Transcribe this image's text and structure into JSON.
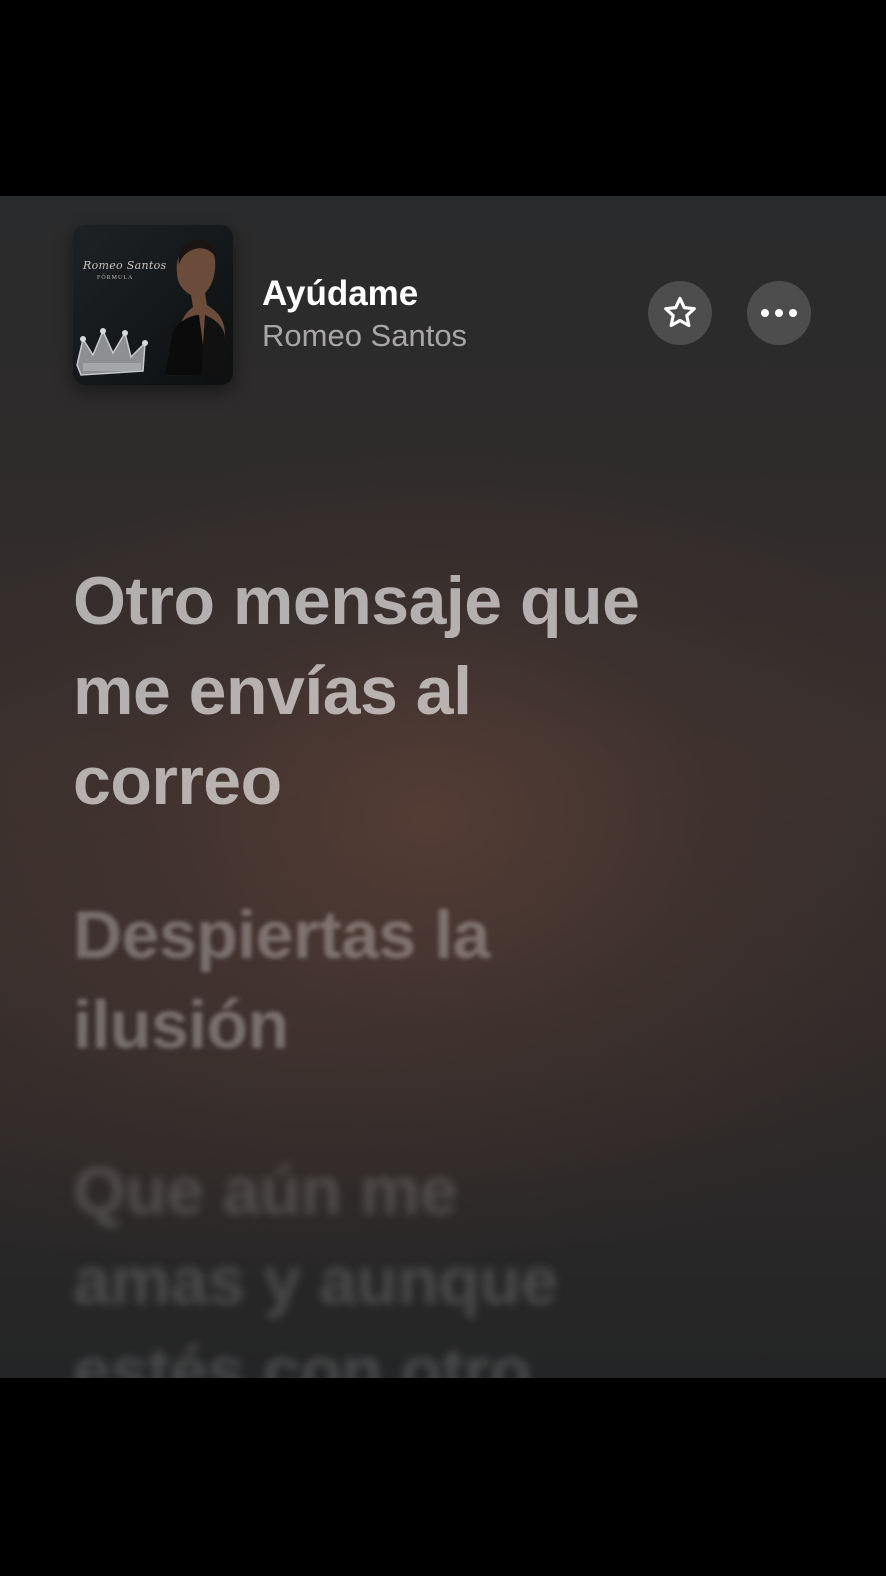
{
  "now_playing": {
    "title": "Ayúdame",
    "artist": "Romeo Santos",
    "artwork": {
      "album_script": "Romeo Santos",
      "album_sub": "FÓRMULA"
    }
  },
  "actions": {
    "favorite_icon": "star-icon",
    "more_icon": "ellipsis-icon"
  },
  "lyrics": {
    "current": "Otro mensaje que\nme envías al\ncorreo",
    "next": "Despiertas la\nilusión",
    "later": "Que aún me\namas y aunque\nestés con otro"
  },
  "colors": {
    "title": "#ffffff",
    "artist": "#a9a7a6",
    "background_warm": "#3a302d",
    "background_cool": "#242526"
  }
}
